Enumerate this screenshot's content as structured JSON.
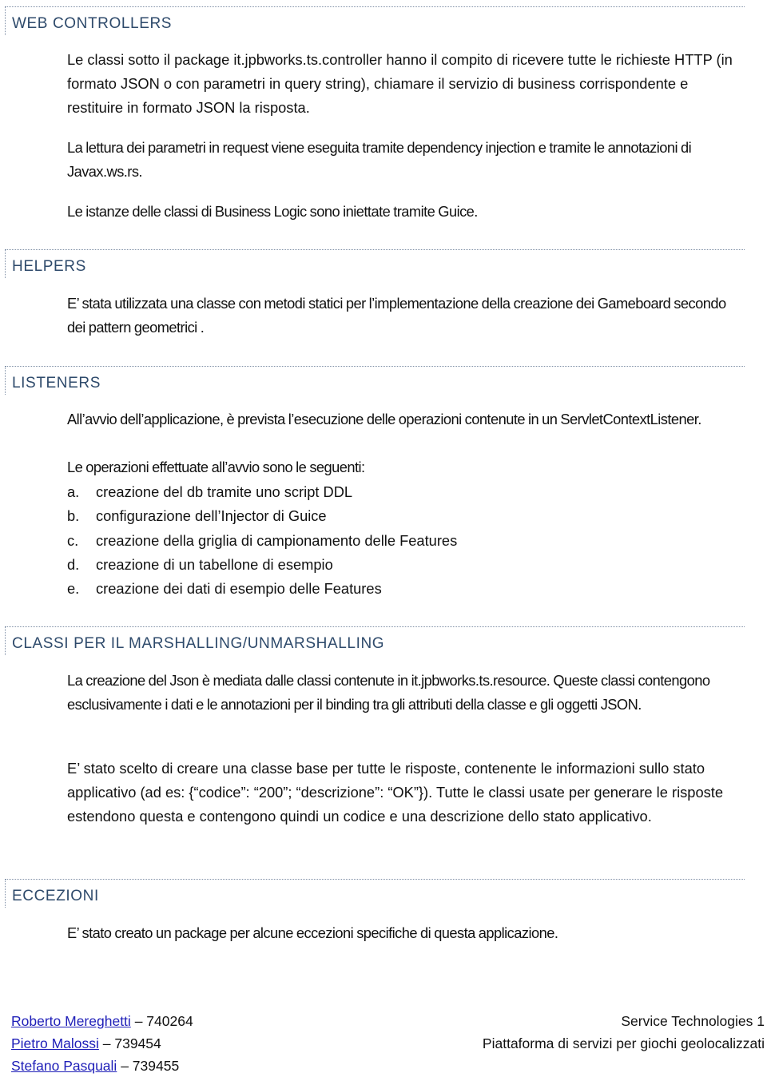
{
  "sections": [
    {
      "title": "WEB CONTROLLERS",
      "paragraphs": [
        "Le classi sotto il package it.jpbworks.ts.controller hanno il compito di ricevere tutte le richieste HTTP (in formato JSON o con parametri in query string), chiamare il servizio di business corrispondente e restituire in formato JSON la risposta.",
        "La lettura dei parametri in request viene eseguita tramite dependency injection e tramite le annotazioni  di Javax.ws.rs.",
        "Le istanze delle classi di Business Logic sono iniettate tramite Guice."
      ]
    },
    {
      "title": "HELPERS",
      "paragraphs": [
        "E’ stata utilizzata una classe con metodi statici per l’implementazione della creazione dei Gameboard secondo dei pattern geometrici ."
      ]
    },
    {
      "title": "LISTENERS",
      "paragraphs": [
        "All’avvio dell’applicazione, è prevista l’esecuzione delle operazioni contenute in un ServletContextListener.",
        "Le operazioni effettuate all’avvio sono le seguenti:"
      ],
      "list": [
        {
          "marker": "a.",
          "text": "creazione del db tramite uno script DDL"
        },
        {
          "marker": "b.",
          "text": "configurazione dell’Injector di Guice"
        },
        {
          "marker": "c.",
          "text": "creazione della griglia di campionamento delle Features"
        },
        {
          "marker": "d.",
          "text": "creazione di un tabellone di esempio"
        },
        {
          "marker": "e.",
          "text": "creazione dei dati di esempio delle Features"
        }
      ]
    },
    {
      "title": "CLASSI PER IL MARSHALLING/UNMARSHALLING",
      "paragraphs": [
        "La creazione del Json è mediata dalle classi contenute in it.jpbworks.ts.resource. Queste classi contengono esclusivamente i dati e le annotazioni per il binding tra gli attributi della classe e gli oggetti JSON.",
        "E’ stato scelto di creare una classe base per tutte le risposte, contenente le informazioni sullo stato applicativo (ad es: {“codice”: “200”; “descrizione”: “OK”}). Tutte le classi usate per generare le  risposte estendono questa e contengono quindi un codice e una descrizione dello stato applicativo."
      ]
    },
    {
      "title": "ECCEZIONI",
      "paragraphs": [
        "E’ stato creato un package per alcune eccezioni specifiche di questa applicazione."
      ]
    }
  ],
  "footer": {
    "authors": [
      {
        "name": "Roberto Mereghetti",
        "id": "– 740264"
      },
      {
        "name": "Pietro Malossi",
        "id": "– 739454"
      },
      {
        "name": "Stefano Pasquali",
        "id": "– 739455"
      }
    ],
    "course": "Service Technologies 1",
    "project": "Piattaforma di servizi per giochi geolocalizzati"
  },
  "colors": {
    "heading": "#2e4a6b",
    "link": "#1f1fb8",
    "text": "#111111"
  }
}
